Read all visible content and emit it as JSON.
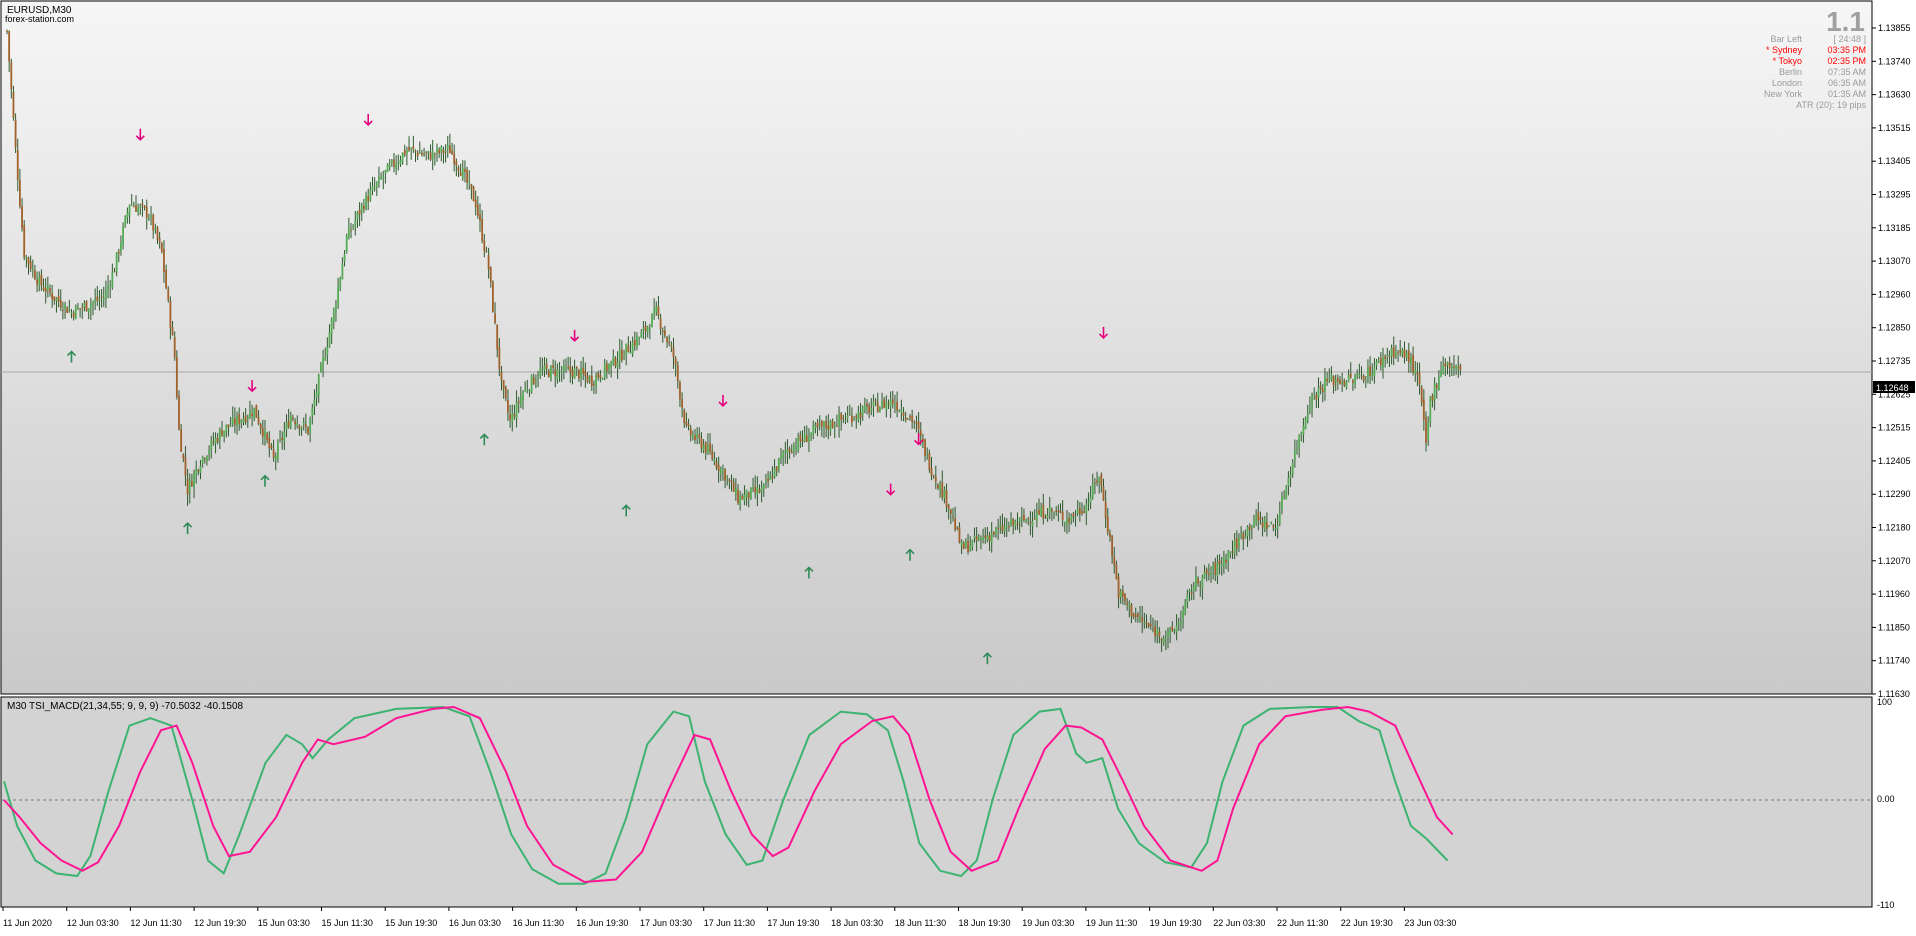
{
  "chart_window": {
    "symbol_label": "EURUSD,M30",
    "watermark": "forex-station.com"
  },
  "info_panel": {
    "version": "1.1",
    "rows": [
      {
        "label": "Bar Left",
        "value": "[ 24:48 ]",
        "color": "#9a9a9a"
      },
      {
        "label": "* Sydney",
        "value": "03:35 PM",
        "color": "#ff0000"
      },
      {
        "label": "* Tokyo",
        "value": "02:35 PM",
        "color": "#ff0000"
      },
      {
        "label": "Berlin",
        "value": "07:35 AM",
        "color": "#9a9a9a"
      },
      {
        "label": "London",
        "value": "06:35 AM",
        "color": "#9a9a9a"
      },
      {
        "label": "New York",
        "value": "01:35 AM",
        "color": "#9a9a9a"
      }
    ],
    "atr_text": "ATR (20): 19 pips"
  },
  "price_axis": {
    "labels": [
      "1.13855",
      "1.13740",
      "1.13630",
      "1.13515",
      "1.13405",
      "1.13295",
      "1.13185",
      "1.13070",
      "1.12960",
      "1.12850",
      "1.12735",
      "1.12625",
      "1.12515",
      "1.12405",
      "1.12290",
      "1.12180",
      "1.12070",
      "1.11960",
      "1.11850",
      "1.11740",
      "1.11630"
    ],
    "current_price": "1.12648"
  },
  "indicator": {
    "label": "M30 TSI_MACD(21,34,55; 9, 9, 9) -70.5032 -40.1508",
    "axis_labels": [
      "100",
      "0.00",
      "-110"
    ]
  },
  "time_axis": {
    "labels": [
      "11 Jun 2020",
      "12 Jun 03:30",
      "12 Jun 11:30",
      "12 Jun 19:30",
      "15 Jun 03:30",
      "15 Jun 11:30",
      "15 Jun 19:30",
      "16 Jun 03:30",
      "16 Jun 11:30",
      "16 Jun 19:30",
      "17 Jun 03:30",
      "17 Jun 11:30",
      "17 Jun 19:30",
      "18 Jun 03:30",
      "18 Jun 11:30",
      "18 Jun 19:30",
      "19 Jun 03:30",
      "19 Jun 11:30",
      "19 Jun 19:30",
      "22 Jun 03:30",
      "22 Jun 11:30",
      "22 Jun 19:30",
      "23 Jun 03:30"
    ]
  },
  "colors": {
    "bull_candle": "#55aa55",
    "bear_candle": "#a0602a",
    "wick": "#2d5a2d",
    "up_arrow": "#2e8b57",
    "down_arrow": "#e6007e",
    "tsi_green": "#3cb371",
    "tsi_pink": "#ff1493"
  },
  "chart_data": {
    "type": "candlestick",
    "price_range": [
      1.1163,
      1.13855
    ],
    "close_path": [
      [
        0,
        1.138
      ],
      [
        4,
        1.134
      ],
      [
        8,
        1.1305
      ],
      [
        15,
        1.1295
      ],
      [
        22,
        1.129
      ],
      [
        30,
        1.1285
      ],
      [
        45,
        1.129
      ],
      [
        50,
        1.13
      ],
      [
        57,
        1.1322
      ],
      [
        66,
        1.1318
      ],
      [
        72,
        1.1305
      ],
      [
        78,
        1.127
      ],
      [
        80,
        1.1245
      ],
      [
        84,
        1.1225
      ],
      [
        90,
        1.1235
      ],
      [
        100,
        1.1245
      ],
      [
        115,
        1.1252
      ],
      [
        119,
        1.1245
      ],
      [
        124,
        1.1235
      ],
      [
        132,
        1.125
      ],
      [
        140,
        1.1245
      ],
      [
        146,
        1.1265
      ],
      [
        152,
        1.1285
      ],
      [
        158,
        1.131
      ],
      [
        166,
        1.1322
      ],
      [
        176,
        1.1332
      ],
      [
        186,
        1.134
      ],
      [
        196,
        1.1338
      ],
      [
        206,
        1.134
      ],
      [
        212,
        1.1332
      ],
      [
        218,
        1.1322
      ],
      [
        224,
        1.13
      ],
      [
        230,
        1.126
      ],
      [
        234,
        1.1248
      ],
      [
        240,
        1.1258
      ],
      [
        248,
        1.1265
      ],
      [
        264,
        1.1265
      ],
      [
        272,
        1.1262
      ],
      [
        282,
        1.1268
      ],
      [
        296,
        1.1278
      ],
      [
        302,
        1.1285
      ],
      [
        310,
        1.127
      ],
      [
        316,
        1.1245
      ],
      [
        324,
        1.124
      ],
      [
        334,
        1.123
      ],
      [
        340,
        1.1222
      ],
      [
        352,
        1.1225
      ],
      [
        362,
        1.1238
      ],
      [
        376,
        1.1245
      ],
      [
        386,
        1.1248
      ],
      [
        400,
        1.1252
      ],
      [
        412,
        1.1255
      ],
      [
        422,
        1.1248
      ],
      [
        430,
        1.1232
      ],
      [
        438,
        1.122
      ],
      [
        444,
        1.1205
      ],
      [
        452,
        1.1208
      ],
      [
        464,
        1.1212
      ],
      [
        474,
        1.1215
      ],
      [
        484,
        1.1218
      ],
      [
        494,
        1.1215
      ],
      [
        502,
        1.122
      ],
      [
        508,
        1.123
      ],
      [
        513,
        1.1208
      ],
      [
        517,
        1.119
      ],
      [
        525,
        1.1182
      ],
      [
        532,
        1.1178
      ],
      [
        540,
        1.1175
      ],
      [
        545,
        1.118
      ],
      [
        552,
        1.1193
      ],
      [
        562,
        1.1198
      ],
      [
        570,
        1.1205
      ],
      [
        580,
        1.1215
      ],
      [
        590,
        1.1212
      ],
      [
        598,
        1.1235
      ],
      [
        606,
        1.1255
      ],
      [
        614,
        1.1262
      ],
      [
        626,
        1.1262
      ],
      [
        634,
        1.1265
      ],
      [
        644,
        1.1272
      ],
      [
        652,
        1.127
      ],
      [
        657,
        1.126
      ],
      [
        660,
        1.124
      ],
      [
        662,
        1.1255
      ],
      [
        668,
        1.1268
      ],
      [
        673,
        1.1266
      ],
      [
        676,
        1.1265
      ]
    ],
    "signal_arrows": {
      "up": [
        [
          30,
          1.127
        ],
        [
          84,
          1.1212
        ],
        [
          120,
          1.1228
        ],
        [
          222,
          1.1242
        ],
        [
          288,
          1.1218
        ],
        [
          373,
          1.1197
        ],
        [
          420,
          1.1203
        ],
        [
          456,
          1.1168
        ]
      ],
      "down": [
        [
          62,
          1.1345
        ],
        [
          168,
          1.135
        ],
        [
          114,
          1.126
        ],
        [
          264,
          1.1277
        ],
        [
          333,
          1.1255
        ],
        [
          411,
          1.1225
        ],
        [
          424,
          1.1242
        ],
        [
          510,
          1.1278
        ]
      ]
    },
    "tsi_green": [
      [
        0,
        20
      ],
      [
        5,
        -30
      ],
      [
        12,
        -70
      ],
      [
        20,
        -85
      ],
      [
        28,
        -88
      ],
      [
        33,
        -65
      ],
      [
        40,
        10
      ],
      [
        48,
        80
      ],
      [
        56,
        88
      ],
      [
        64,
        80
      ],
      [
        72,
        0
      ],
      [
        78,
        -70
      ],
      [
        84,
        -85
      ],
      [
        90,
        -40
      ],
      [
        100,
        40
      ],
      [
        108,
        70
      ],
      [
        114,
        60
      ],
      [
        118,
        45
      ],
      [
        124,
        65
      ],
      [
        134,
        88
      ],
      [
        150,
        98
      ],
      [
        168,
        100
      ],
      [
        178,
        90
      ],
      [
        186,
        30
      ],
      [
        194,
        -40
      ],
      [
        202,
        -80
      ],
      [
        212,
        -97
      ],
      [
        222,
        -97
      ],
      [
        230,
        -85
      ],
      [
        238,
        -20
      ],
      [
        246,
        60
      ],
      [
        256,
        95
      ],
      [
        262,
        90
      ],
      [
        268,
        20
      ],
      [
        276,
        -40
      ],
      [
        284,
        -75
      ],
      [
        290,
        -70
      ],
      [
        298,
        0
      ],
      [
        308,
        70
      ],
      [
        320,
        95
      ],
      [
        330,
        92
      ],
      [
        338,
        75
      ],
      [
        344,
        20
      ],
      [
        350,
        -50
      ],
      [
        358,
        -82
      ],
      [
        366,
        -88
      ],
      [
        372,
        -70
      ],
      [
        378,
        0
      ],
      [
        386,
        70
      ],
      [
        396,
        95
      ],
      [
        404,
        98
      ],
      [
        410,
        50
      ],
      [
        414,
        40
      ],
      [
        420,
        45
      ],
      [
        426,
        -10
      ],
      [
        434,
        -50
      ],
      [
        444,
        -72
      ],
      [
        454,
        -78
      ],
      [
        460,
        -50
      ],
      [
        466,
        20
      ],
      [
        474,
        80
      ],
      [
        484,
        98
      ],
      [
        500,
        100
      ],
      [
        510,
        100
      ],
      [
        518,
        85
      ],
      [
        526,
        75
      ],
      [
        532,
        20
      ],
      [
        538,
        -30
      ],
      [
        544,
        -45
      ],
      [
        552,
        -70
      ]
    ],
    "tsi_pink": [
      [
        0,
        0
      ],
      [
        6,
        -20
      ],
      [
        14,
        -50
      ],
      [
        22,
        -70
      ],
      [
        30,
        -82
      ],
      [
        36,
        -72
      ],
      [
        44,
        -30
      ],
      [
        52,
        30
      ],
      [
        60,
        75
      ],
      [
        66,
        80
      ],
      [
        72,
        40
      ],
      [
        80,
        -30
      ],
      [
        86,
        -65
      ],
      [
        94,
        -60
      ],
      [
        104,
        -20
      ],
      [
        114,
        40
      ],
      [
        120,
        65
      ],
      [
        126,
        60
      ],
      [
        138,
        68
      ],
      [
        150,
        88
      ],
      [
        164,
        98
      ],
      [
        172,
        100
      ],
      [
        182,
        88
      ],
      [
        192,
        30
      ],
      [
        200,
        -30
      ],
      [
        210,
        -75
      ],
      [
        222,
        -95
      ],
      [
        234,
        -92
      ],
      [
        244,
        -60
      ],
      [
        254,
        10
      ],
      [
        264,
        70
      ],
      [
        270,
        65
      ],
      [
        278,
        10
      ],
      [
        286,
        -40
      ],
      [
        294,
        -65
      ],
      [
        300,
        -55
      ],
      [
        310,
        10
      ],
      [
        320,
        60
      ],
      [
        332,
        85
      ],
      [
        340,
        90
      ],
      [
        346,
        70
      ],
      [
        354,
        0
      ],
      [
        362,
        -60
      ],
      [
        370,
        -82
      ],
      [
        380,
        -70
      ],
      [
        388,
        -10
      ],
      [
        398,
        55
      ],
      [
        406,
        80
      ],
      [
        412,
        78
      ],
      [
        420,
        65
      ],
      [
        428,
        20
      ],
      [
        436,
        -30
      ],
      [
        446,
        -70
      ],
      [
        458,
        -82
      ],
      [
        464,
        -70
      ],
      [
        470,
        -10
      ],
      [
        480,
        60
      ],
      [
        490,
        90
      ],
      [
        504,
        97
      ],
      [
        514,
        100
      ],
      [
        522,
        95
      ],
      [
        532,
        80
      ],
      [
        540,
        30
      ],
      [
        548,
        -20
      ],
      [
        554,
        -40
      ]
    ]
  }
}
